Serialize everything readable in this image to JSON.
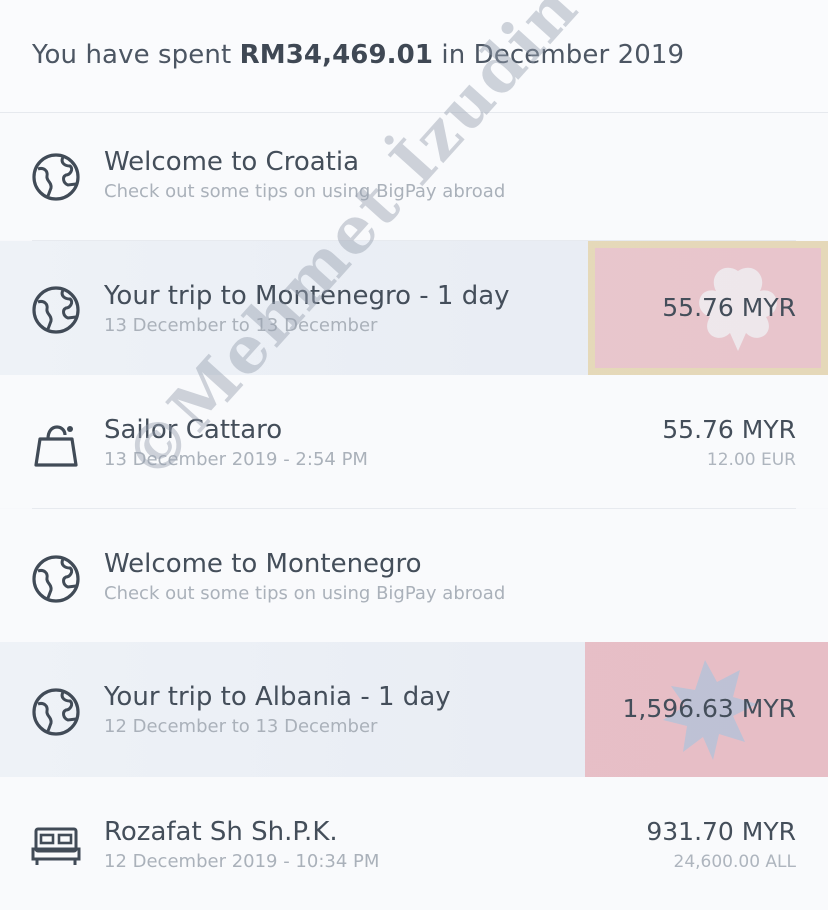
{
  "summary": {
    "prefix": "You have spent ",
    "amount": "RM34,469.01",
    "suffix": " in December 2019"
  },
  "items": [
    {
      "icon": "globe-icon",
      "title": "Welcome to Croatia",
      "subtitle": "Check out some tips on using BigPay abroad",
      "amount": "",
      "amount_secondary": ""
    },
    {
      "icon": "globe-icon",
      "title": "Your trip to Montenegro - 1 day",
      "subtitle": "13 December to 13 December",
      "amount": "55.76 MYR",
      "amount_secondary": ""
    },
    {
      "icon": "shopping-bag-icon",
      "title": "Sailor Cattaro",
      "subtitle": "13 December 2019 - 2:54 PM",
      "amount": "55.76 MYR",
      "amount_secondary": "12.00 EUR"
    },
    {
      "icon": "globe-icon",
      "title": "Welcome to Montenegro",
      "subtitle": "Check out some tips on using BigPay abroad",
      "amount": "",
      "amount_secondary": ""
    },
    {
      "icon": "globe-icon",
      "title": "Your trip to Albania - 1 day",
      "subtitle": "12 December to 13 December",
      "amount": "1,596.63 MYR",
      "amount_secondary": ""
    },
    {
      "icon": "bed-icon",
      "title": "Rozafat Sh Sh.P.K.",
      "subtitle": "12 December 2019 - 10:34 PM",
      "amount": "931.70 MYR",
      "amount_secondary": "24,600.00 ALL"
    }
  ],
  "watermark": "©Mehmet İzudin Gül",
  "colors": {
    "flag_red": "#e58a94",
    "text": "#444e5a",
    "muted": "#aab1ba"
  }
}
